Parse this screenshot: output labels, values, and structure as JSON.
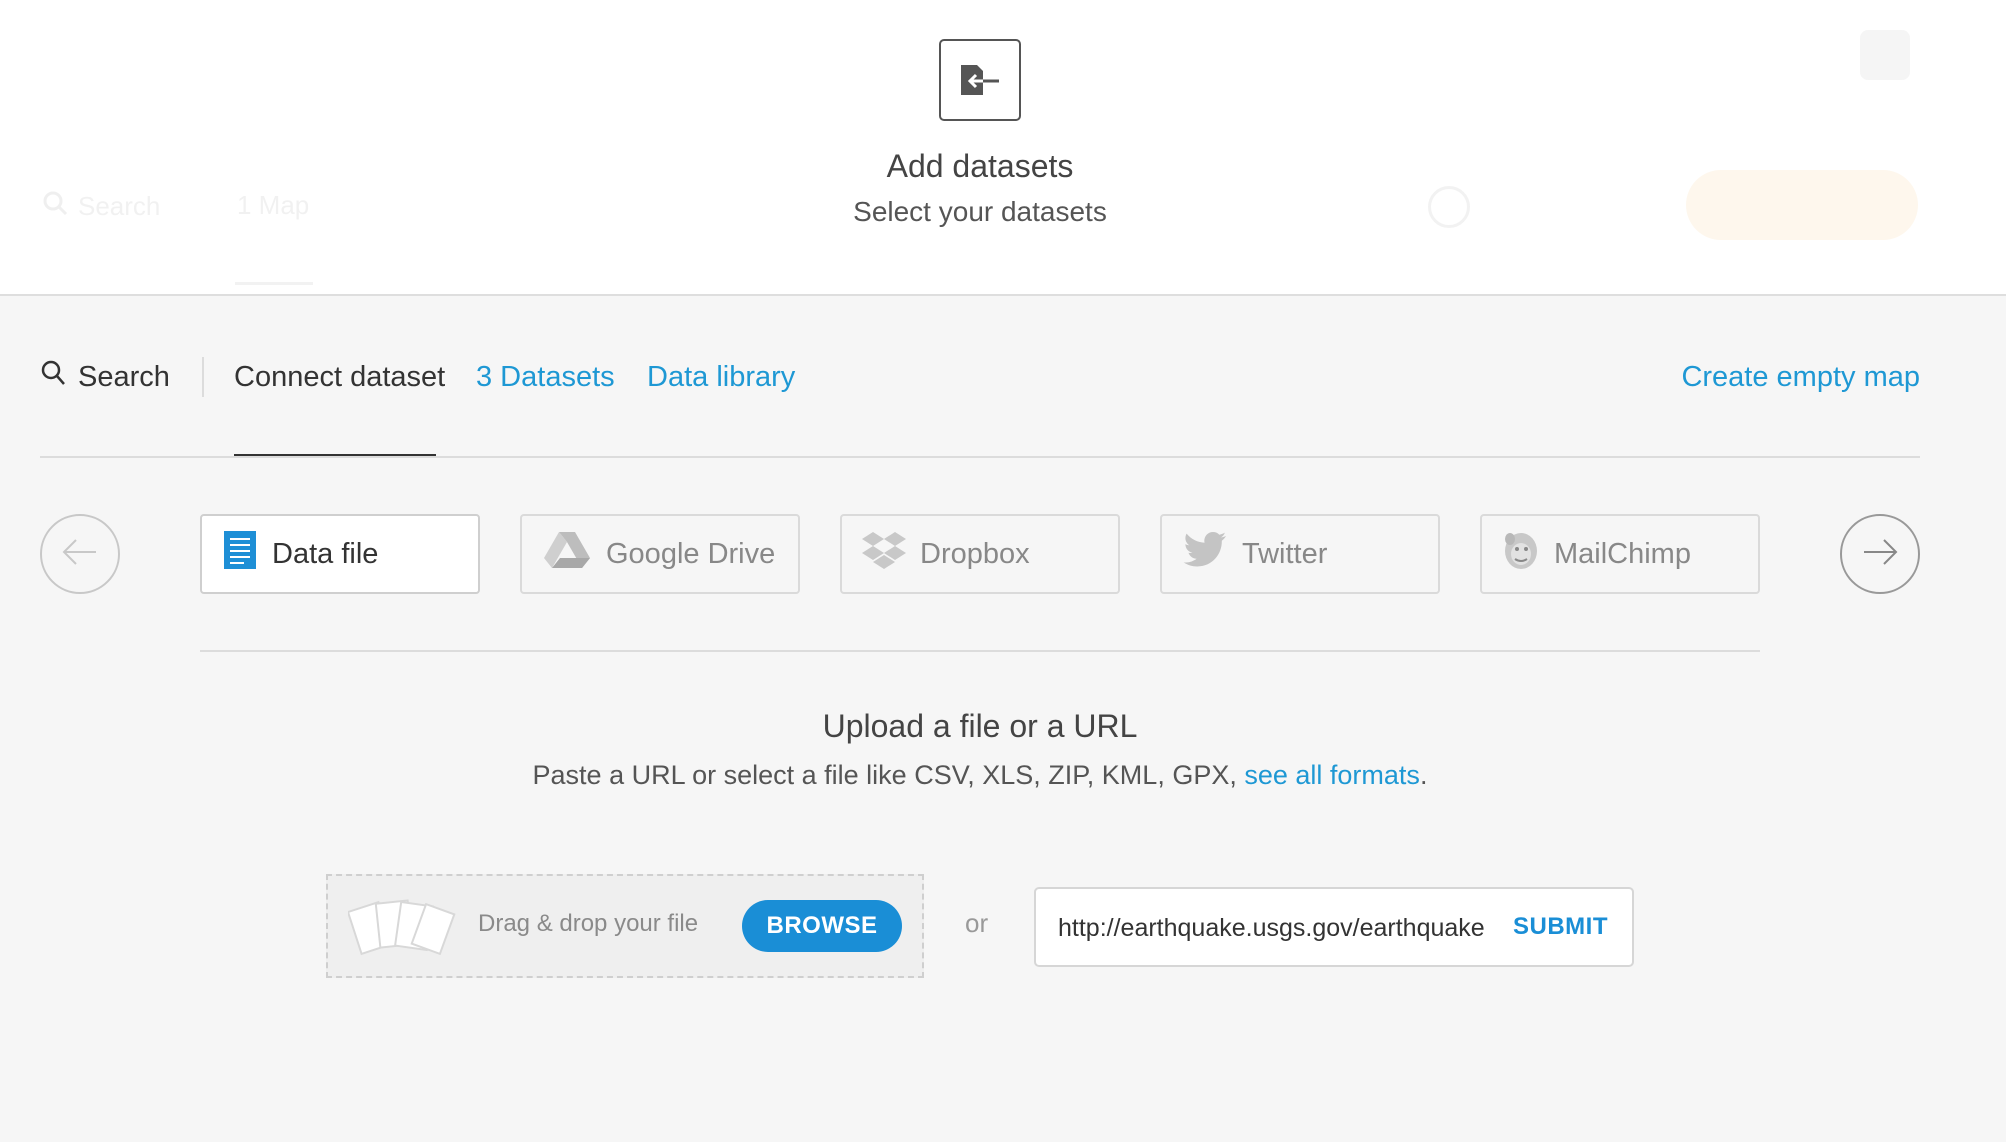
{
  "background_header": {
    "search_label": "Search",
    "map_tab": "1 Map"
  },
  "header": {
    "icon": "import-arrow-icon",
    "title": "Add datasets",
    "subtitle": "Select your datasets"
  },
  "nav": {
    "search_label": "Search",
    "tabs": [
      {
        "label": "Connect dataset",
        "active": true
      },
      {
        "label": "3 Datasets",
        "active": false
      },
      {
        "label": "Data library",
        "active": false
      }
    ],
    "create_empty_map": "Create empty map"
  },
  "sources": [
    {
      "label": "Data file",
      "icon": "document-icon",
      "active": true
    },
    {
      "label": "Google Drive",
      "icon": "google-drive-icon",
      "active": false
    },
    {
      "label": "Dropbox",
      "icon": "dropbox-icon",
      "active": false
    },
    {
      "label": "Twitter",
      "icon": "twitter-icon",
      "active": false
    },
    {
      "label": "MailChimp",
      "icon": "mailchimp-icon",
      "active": false
    }
  ],
  "upload": {
    "title": "Upload a file or a URL",
    "description": "Paste a URL or select a file like CSV, XLS, ZIP, KML, GPX,",
    "formats_link": "see all formats",
    "description_end": ".",
    "drop_text": "Drag & drop your file",
    "browse_label": "BROWSE",
    "or_label": "or",
    "url_value": "http://earthquake.usgs.gov/earthquake",
    "submit_label": "SUBMIT"
  },
  "colors": {
    "accent": "#1e98d4",
    "button": "#1a8ed6",
    "background": "#f6f6f6"
  }
}
